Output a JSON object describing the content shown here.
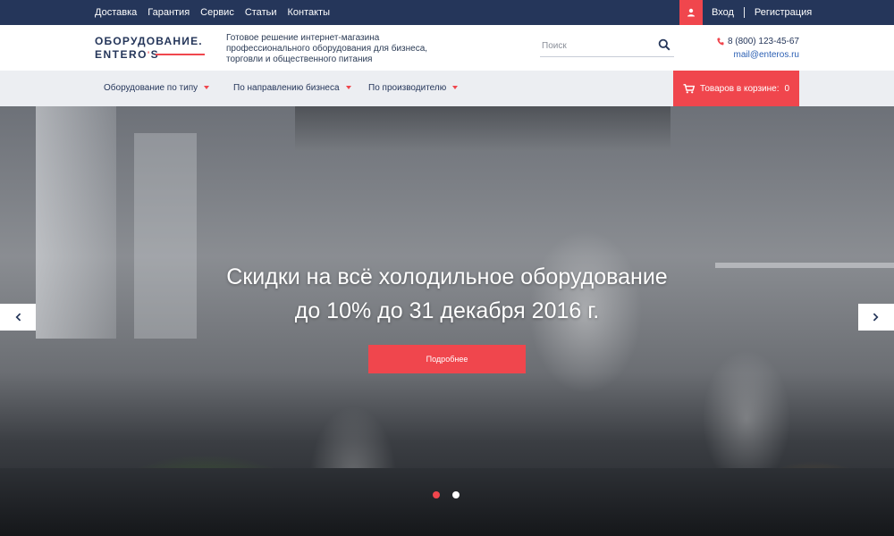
{
  "topnav": {
    "items": [
      "Доставка",
      "Гарантия",
      "Сервис",
      "Статьи",
      "Контакты"
    ]
  },
  "auth": {
    "login": "Вход",
    "register": "Регистрация"
  },
  "logo": {
    "line1": "ОБОРУДОВАНИЕ.",
    "line2_a": "ENTERO",
    "line2_apos": "'",
    "line2_b": "S"
  },
  "header": {
    "tagline": "Готовое решение интернет-магазина профессионального оборудования для бизнеса, торговли и общественного питания",
    "search_placeholder": "Поиск",
    "phone": "8 (800) 123-45-67",
    "email": "mail@enteros.ru"
  },
  "catbar": {
    "items": [
      "Оборудование по типу",
      "По направлению бизнеса",
      "По производителю"
    ],
    "cart_label": "Товаров в корзине:",
    "cart_count": "0"
  },
  "hero": {
    "title_line1": "Скидки на всё холодильное оборудование",
    "title_line2": "до 10% до 31 декабря 2016 г.",
    "button": "Подробнее",
    "slides_total": 2,
    "active_slide": 1
  },
  "colors": {
    "navy": "#25365a",
    "accent": "#f0464d",
    "catbar_bg": "#eceef2",
    "link": "#2b5fb3"
  },
  "icons": {
    "user": "user-icon",
    "search": "search-icon",
    "phone": "phone-icon",
    "cart": "cart-icon",
    "prev": "chevron-left-icon",
    "next": "chevron-right-icon"
  }
}
